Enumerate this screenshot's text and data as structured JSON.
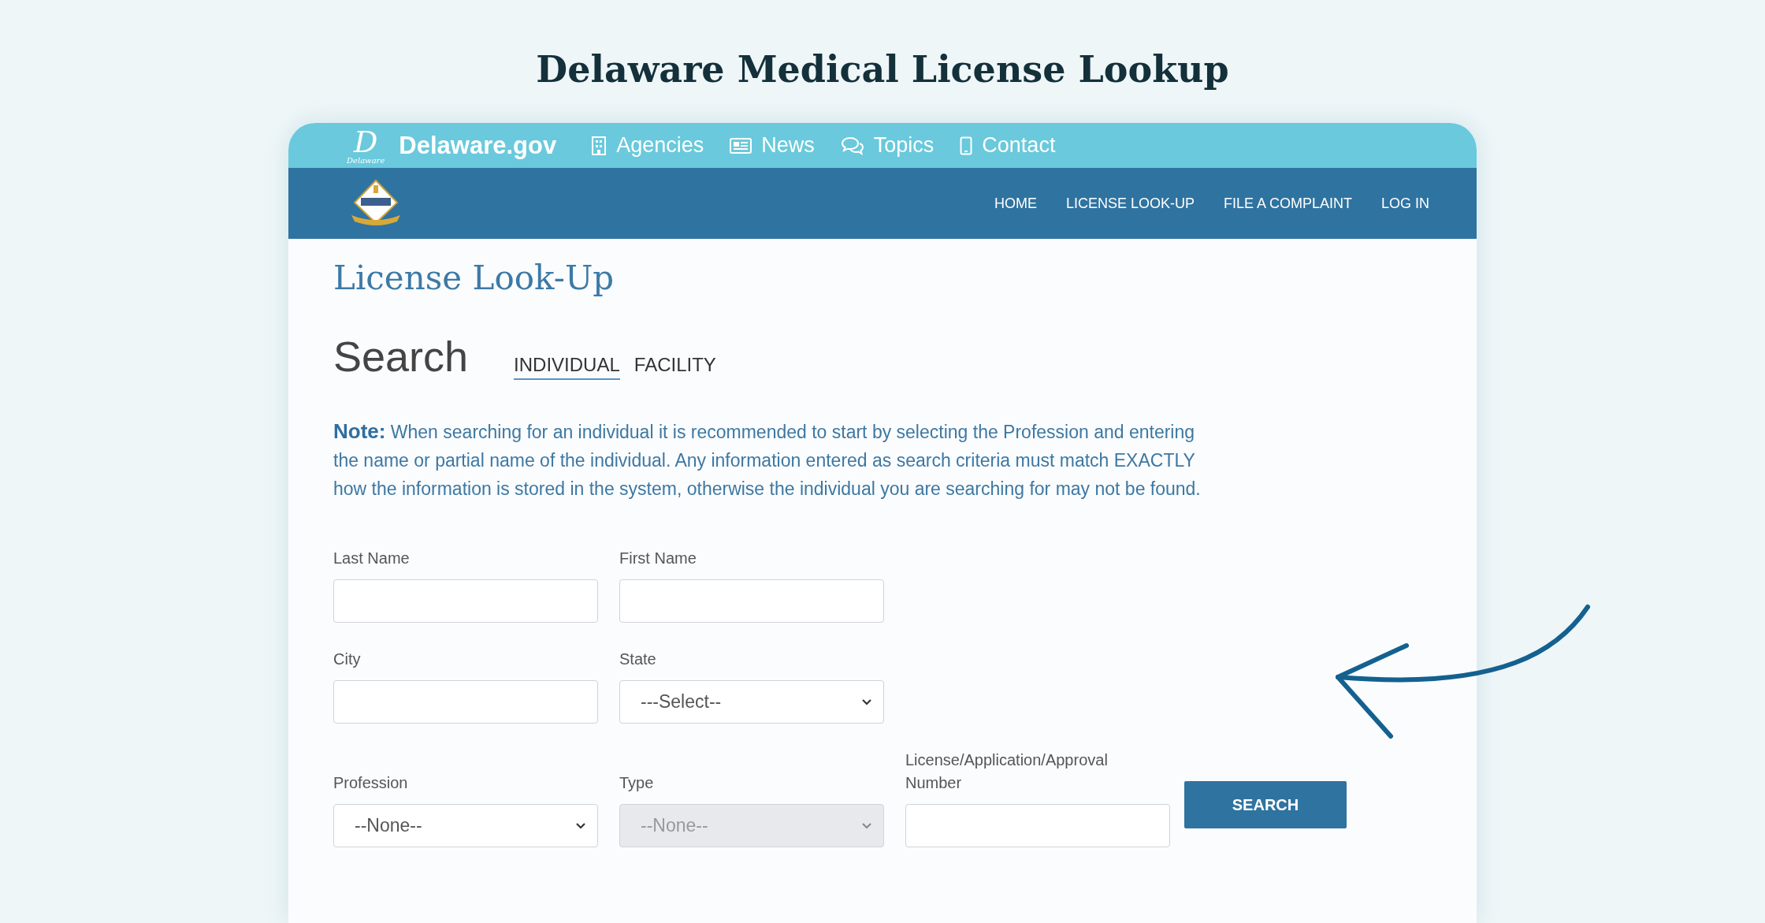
{
  "heading": "Delaware Medical License Lookup",
  "top_bar": {
    "logo_letter": "D",
    "brand": "Delaware.gov",
    "brand_small": "Delaware",
    "links": [
      {
        "label": "Agencies"
      },
      {
        "label": "News"
      },
      {
        "label": "Topics"
      },
      {
        "label": "Contact"
      }
    ]
  },
  "nav": {
    "items": [
      "HOME",
      "LICENSE LOOK-UP",
      "FILE A COMPLAINT",
      "LOG IN"
    ]
  },
  "page_title": "License Look-Up",
  "search": {
    "title": "Search",
    "tabs": [
      {
        "label": "INDIVIDUAL",
        "selected": true
      },
      {
        "label": "FACILITY",
        "selected": false
      }
    ]
  },
  "note": {
    "label": "Note:",
    "text": "When searching for an individual it is recommended to start by selecting the Profession and entering the name or partial name of the individual. Any information entered as search criteria must match EXACTLY how the information is stored in the system, otherwise the individual you are searching for may not be found."
  },
  "fields": [
    {
      "label": "Last Name",
      "kind": "text"
    },
    {
      "label": "First Name",
      "kind": "text"
    },
    {
      "label": "City",
      "kind": "text"
    },
    {
      "label": "State",
      "kind": "select",
      "value": "---Select--"
    },
    {
      "label": "Profession",
      "kind": "select",
      "value": "--None--"
    },
    {
      "label": "Type",
      "kind": "select",
      "value": "--None--",
      "disabled": true
    },
    {
      "label": "License/Application/Approval Number",
      "kind": "text"
    }
  ],
  "button": "SEARCH"
}
